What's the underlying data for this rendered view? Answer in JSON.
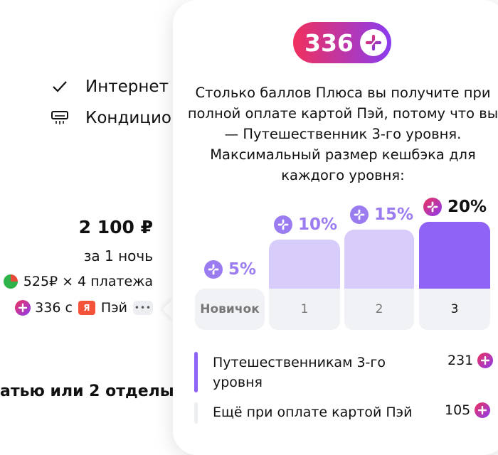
{
  "amenities": [
    {
      "icon": "check-icon",
      "label": "Интернет"
    },
    {
      "icon": "air-conditioner-icon",
      "label": "Кондицио"
    }
  ],
  "offer": {
    "price": "2 100 ₽",
    "per_night": "за 1 ночь",
    "split_text": "525₽ × 4 платежа",
    "points_prefix": "336 с",
    "pay_logo": "Я",
    "pay_label": "Пэй",
    "more_label": "•••"
  },
  "bottom_text": "атью или 2 отделы",
  "popup": {
    "badge_value": "336",
    "description": "Столько баллов Плюса вы получите при полной оплате картой Пэй, потому что вы — Путешественник 3-го уровня. Максимальный размер кешбэка для каждого уровня:",
    "levels": [
      {
        "name": "Новичок",
        "percent": "5%",
        "bar_fraction": 0
      },
      {
        "name": "1",
        "percent": "10%",
        "bar_fraction": 0.72
      },
      {
        "name": "2",
        "percent": "15%",
        "bar_fraction": 0.86
      },
      {
        "name": "3",
        "percent": "20%",
        "bar_fraction": 1
      }
    ],
    "rows": [
      {
        "label": "Путешественникам 3-го уровня",
        "value": "231"
      },
      {
        "label": "Ещё при оплате картой Пэй",
        "value": "105"
      }
    ]
  },
  "colors": {
    "accent_purple": "#8f63f5",
    "light_purple": "#d8ccfb",
    "gradient_start": "#f0305c",
    "gradient_end": "#8a3cf0"
  }
}
